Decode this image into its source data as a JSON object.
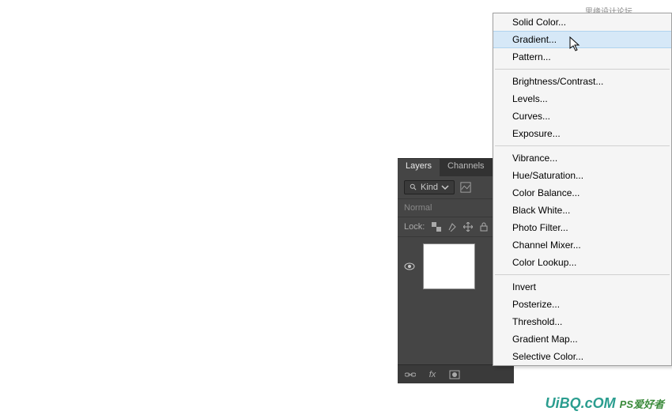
{
  "watermark": {
    "top": "思缘设计论坛 www.MISSYUAN.com",
    "bottomLogo": "UiBQ.cOM",
    "bottomCn": "PS爱好者"
  },
  "layersPanel": {
    "tabs": {
      "layers": "Layers",
      "channels": "Channels"
    },
    "kindSearch": "Kind",
    "blendMode": "Normal",
    "lockLabel": "Lock:",
    "footerFx": "fx"
  },
  "contextMenu": {
    "groups": [
      [
        {
          "key": "solid-color",
          "label": "Solid Color..."
        },
        {
          "key": "gradient",
          "label": "Gradient...",
          "highlighted": true
        },
        {
          "key": "pattern",
          "label": "Pattern..."
        }
      ],
      [
        {
          "key": "brightness-contrast",
          "label": "Brightness/Contrast..."
        },
        {
          "key": "levels",
          "label": "Levels..."
        },
        {
          "key": "curves",
          "label": "Curves..."
        },
        {
          "key": "exposure",
          "label": "Exposure..."
        }
      ],
      [
        {
          "key": "vibrance",
          "label": "Vibrance..."
        },
        {
          "key": "hue-saturation",
          "label": "Hue/Saturation..."
        },
        {
          "key": "color-balance",
          "label": "Color Balance..."
        },
        {
          "key": "black-white",
          "label": "Black  White..."
        },
        {
          "key": "photo-filter",
          "label": "Photo Filter..."
        },
        {
          "key": "channel-mixer",
          "label": "Channel Mixer..."
        },
        {
          "key": "color-lookup",
          "label": "Color Lookup..."
        }
      ],
      [
        {
          "key": "invert",
          "label": "Invert"
        },
        {
          "key": "posterize",
          "label": "Posterize..."
        },
        {
          "key": "threshold",
          "label": "Threshold..."
        },
        {
          "key": "gradient-map",
          "label": "Gradient Map..."
        },
        {
          "key": "selective-color",
          "label": "Selective Color..."
        }
      ]
    ]
  }
}
